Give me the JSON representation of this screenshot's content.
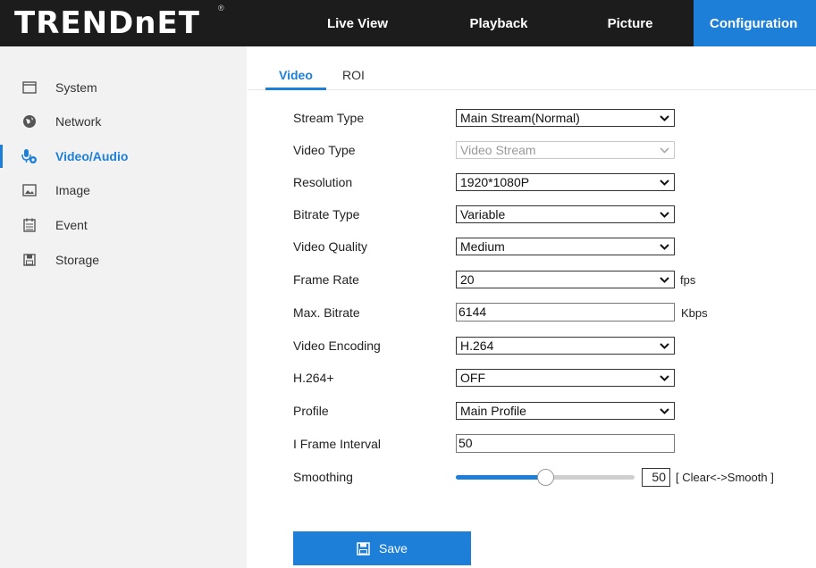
{
  "header": {
    "logo": "TRENDnET",
    "registered_mark": "®",
    "nav": [
      {
        "label": "Live View"
      },
      {
        "label": "Playback"
      },
      {
        "label": "Picture"
      },
      {
        "label": "Configuration",
        "active": true
      }
    ]
  },
  "sidebar": {
    "items": [
      {
        "label": "System",
        "icon": "monitor-icon"
      },
      {
        "label": "Network",
        "icon": "globe-icon"
      },
      {
        "label": "Video/Audio",
        "icon": "microphone-icon",
        "active": true
      },
      {
        "label": "Image",
        "icon": "image-icon"
      },
      {
        "label": "Event",
        "icon": "calendar-icon"
      },
      {
        "label": "Storage",
        "icon": "floppy-icon"
      }
    ]
  },
  "tabs": [
    {
      "label": "Video",
      "active": true
    },
    {
      "label": "ROI"
    }
  ],
  "form": {
    "stream_type": {
      "label": "Stream Type",
      "value": "Main Stream(Normal)"
    },
    "video_type": {
      "label": "Video Type",
      "value": "Video Stream",
      "disabled": true
    },
    "resolution": {
      "label": "Resolution",
      "value": "1920*1080P"
    },
    "bitrate_type": {
      "label": "Bitrate Type",
      "value": "Variable"
    },
    "video_quality": {
      "label": "Video Quality",
      "value": "Medium"
    },
    "frame_rate": {
      "label": "Frame Rate",
      "value": "20",
      "unit": "fps"
    },
    "max_bitrate": {
      "label": "Max. Bitrate",
      "value": "6144",
      "unit": "Kbps"
    },
    "video_encoding": {
      "label": "Video Encoding",
      "value": "H.264"
    },
    "h264plus": {
      "label": "H.264+",
      "value": "OFF"
    },
    "profile": {
      "label": "Profile",
      "value": "Main Profile"
    },
    "i_frame_interval": {
      "label": "I Frame Interval",
      "value": "50"
    },
    "smoothing": {
      "label": "Smoothing",
      "value": "50",
      "level": 0.5,
      "hint": "[ Clear<->Smooth ]"
    }
  },
  "save_label": "Save",
  "colors": {
    "accent": "#1e7fd8",
    "topbar": "#1c1c1c",
    "sidebar": "#f2f2f2"
  }
}
